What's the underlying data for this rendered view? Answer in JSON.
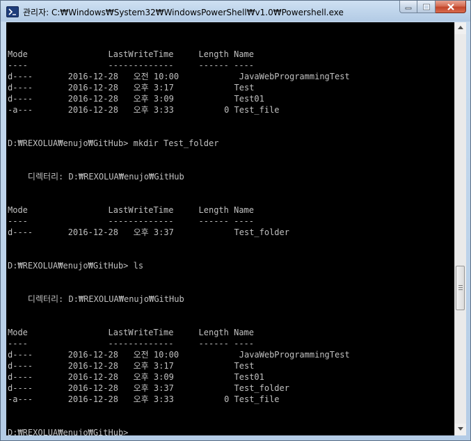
{
  "window": {
    "title": "관리자: C:₩Windows₩System32₩WindowsPowerShell₩v1.0₩Powershell.exe"
  },
  "colors": {
    "console_background": "#000000",
    "console_text": "#c0c0c0",
    "titlebar": "#bdd3ea",
    "close_button": "#c2452b"
  },
  "icons": {
    "app": "powershell-icon",
    "minimize": "minimize-icon",
    "maximize": "maximize-icon",
    "close": "close-icon"
  },
  "console": {
    "lines": [
      "Mode                LastWriteTime     Length Name",
      "----                -------------     ------ ----",
      "d----       2016-12-28   오전 10:00            JavaWebProgrammingTest",
      "d----       2016-12-28   오후 3:17            Test",
      "d----       2016-12-28   오후 3:09            Test01",
      "-a---       2016-12-28   오후 3:33          0 Test_file",
      "",
      "",
      "D:₩REXOLUA₩enujo₩GitHub> mkdir Test_folder",
      "",
      "",
      "    디렉터리: D:₩REXOLUA₩enujo₩GitHub",
      "",
      "",
      "Mode                LastWriteTime     Length Name",
      "----                -------------     ------ ----",
      "d----       2016-12-28   오후 3:37            Test_folder",
      "",
      "",
      "D:₩REXOLUA₩enujo₩GitHub> ls",
      "",
      "",
      "    디렉터리: D:₩REXOLUA₩enujo₩GitHub",
      "",
      "",
      "Mode                LastWriteTime     Length Name",
      "----                -------------     ------ ----",
      "d----       2016-12-28   오전 10:00            JavaWebProgrammingTest",
      "d----       2016-12-28   오후 3:17            Test",
      "d----       2016-12-28   오후 3:09            Test01",
      "d----       2016-12-28   오후 3:37            Test_folder",
      "-a---       2016-12-28   오후 3:33          0 Test_file",
      "",
      "",
      "D:₩REXOLUA₩enujo₩GitHub>"
    ]
  }
}
